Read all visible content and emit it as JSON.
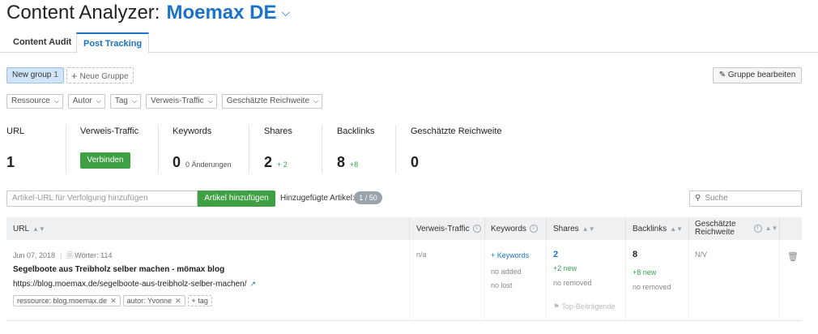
{
  "header": {
    "title": "Content Analyzer:",
    "project": "Moemax DE"
  },
  "tabs": [
    {
      "label": "Content Audit"
    },
    {
      "label": "Post Tracking"
    }
  ],
  "groups": {
    "active_label": "New group",
    "active_count": "1",
    "add_label": "Neue Gruppe",
    "edit_label": "Gruppe bearbeiten"
  },
  "filters": [
    "Ressource",
    "Autor",
    "Tag",
    "Verweis-Traffic",
    "Geschätzte Reichweite"
  ],
  "metrics": {
    "url": {
      "label": "URL",
      "value": "1"
    },
    "referral": {
      "label": "Verweis-Traffic",
      "button": "Verbinden"
    },
    "keywords": {
      "label": "Keywords",
      "value": "0",
      "sub": "0 Änderungen"
    },
    "shares": {
      "label": "Shares",
      "value": "2",
      "delta": "+ 2"
    },
    "backlinks": {
      "label": "Backlinks",
      "value": "8",
      "delta": "+8"
    },
    "reach": {
      "label": "Geschätzte Reichweite",
      "value": "0"
    }
  },
  "add_article": {
    "placeholder": "Artikel-URL für Verfolgung hinzufügen",
    "button": "Artikel hinzufügen",
    "added_label": "Hinzugefügte Artikel:",
    "added_badge": "1 / 50"
  },
  "search": {
    "placeholder": "Suche"
  },
  "table": {
    "headers": {
      "url": "URL",
      "referral": "Verweis-Traffic",
      "keywords": "Keywords",
      "shares": "Shares",
      "backlinks": "Backlinks",
      "reach_line1": "Geschätzte",
      "reach_line2": "Reichweite"
    },
    "rows": [
      {
        "date": "Jun 07, 2018",
        "words": "Wörter: 114",
        "title": "Segelboote aus Treibholz selber machen - mömax blog",
        "url": "https://blog.moemax.de/segelboote-aus-treibholz-selber-machen/",
        "tags": [
          "ressource: blog.moemax.de",
          "autor: Yvonne"
        ],
        "tag_add": "tag",
        "referral": "n/a",
        "keywords_link": "+ Keywords",
        "keywords_added": "no added",
        "keywords_lost": "no lost",
        "shares_value": "2",
        "shares_new": "+2 new",
        "shares_removed": "no removed",
        "shares_top": "Top-Beiträgende",
        "backlinks_value": "8",
        "backlinks_new": "+8 new",
        "backlinks_removed": "no removed",
        "reach": "N/V"
      }
    ]
  }
}
